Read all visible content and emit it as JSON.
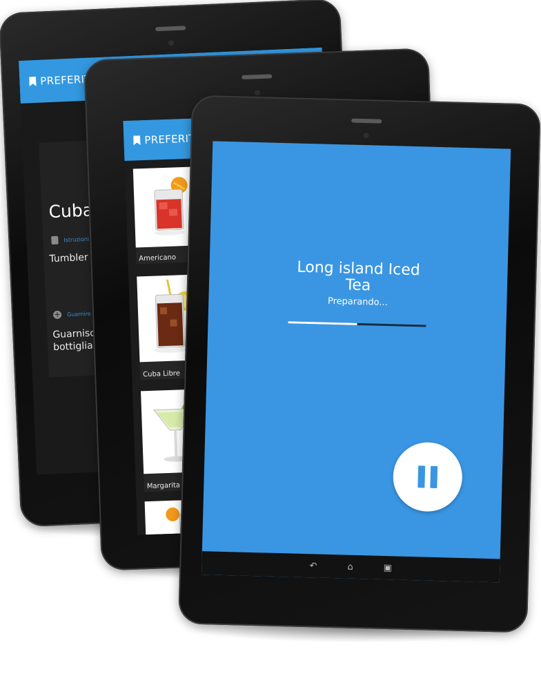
{
  "colors": {
    "accent": "#3398e0",
    "screen_blue": "#3a96e3"
  },
  "detail_app": {
    "header_title": "PREFERITI",
    "drink_title": "Cuba Libre",
    "sections": [
      {
        "icon": "document-icon",
        "label": "Istruzioni",
        "text": "Tumbler pieno di ghiaccio"
      },
      {
        "icon": "plus-circle-icon",
        "label": "Guarnire",
        "text_line1": "Guarnisci con",
        "text_line2": "bottiglia di C"
      }
    ]
  },
  "favorites_app": {
    "header_title": "PREFERITI",
    "items": [
      {
        "name": "Americano",
        "icon": "red-cocktail-icon"
      },
      {
        "name": "Cuba Libre",
        "icon": "cola-glass-icon"
      },
      {
        "name": "Margarita",
        "icon": "margarita-glass-icon"
      },
      {
        "name": "",
        "icon": "orange-cocktail-icon"
      }
    ]
  },
  "preparing_app": {
    "drink_name_line1": "Long island Iced",
    "drink_name_line2": "Tea",
    "status": "Preparando...",
    "progress_percent": 50,
    "pause_icon": "pause-icon",
    "nav_icons": [
      "back-icon",
      "home-icon",
      "recents-icon"
    ]
  }
}
